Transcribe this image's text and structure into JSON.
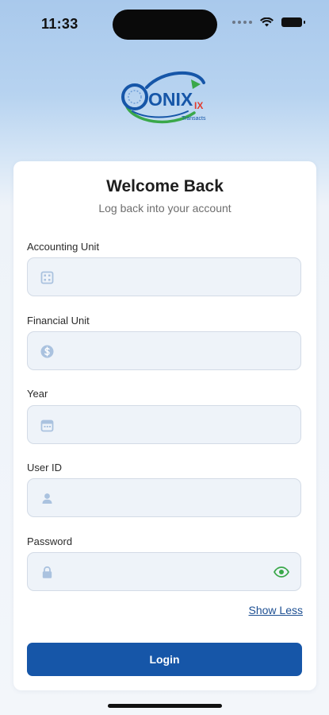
{
  "status_bar": {
    "time": "11:33"
  },
  "logo": {
    "brand": "ONIX",
    "suffix": "IX",
    "tagline": "Transacts"
  },
  "card": {
    "title": "Welcome Back",
    "subtitle": "Log back into your account",
    "fields": [
      {
        "label": "Accounting Unit",
        "value": "",
        "placeholder": "",
        "icon": "building-icon"
      },
      {
        "label": "Financial Unit",
        "value": "",
        "placeholder": "",
        "icon": "dollar-circle-icon"
      },
      {
        "label": "Year",
        "value": "",
        "placeholder": "",
        "icon": "calendar-icon"
      },
      {
        "label": "User ID",
        "value": "",
        "placeholder": "",
        "icon": "user-icon"
      },
      {
        "label": "Password",
        "value": "",
        "placeholder": "",
        "icon": "lock-icon",
        "trailing_icon": "eye-icon"
      }
    ],
    "show_less_label": "Show Less",
    "login_label": "Login"
  },
  "colors": {
    "primary": "#1656a8",
    "link": "#1d4f92",
    "eye_icon": "#3aa84a",
    "field_bg": "#eef3f9",
    "field_icon": "#aac2df"
  }
}
